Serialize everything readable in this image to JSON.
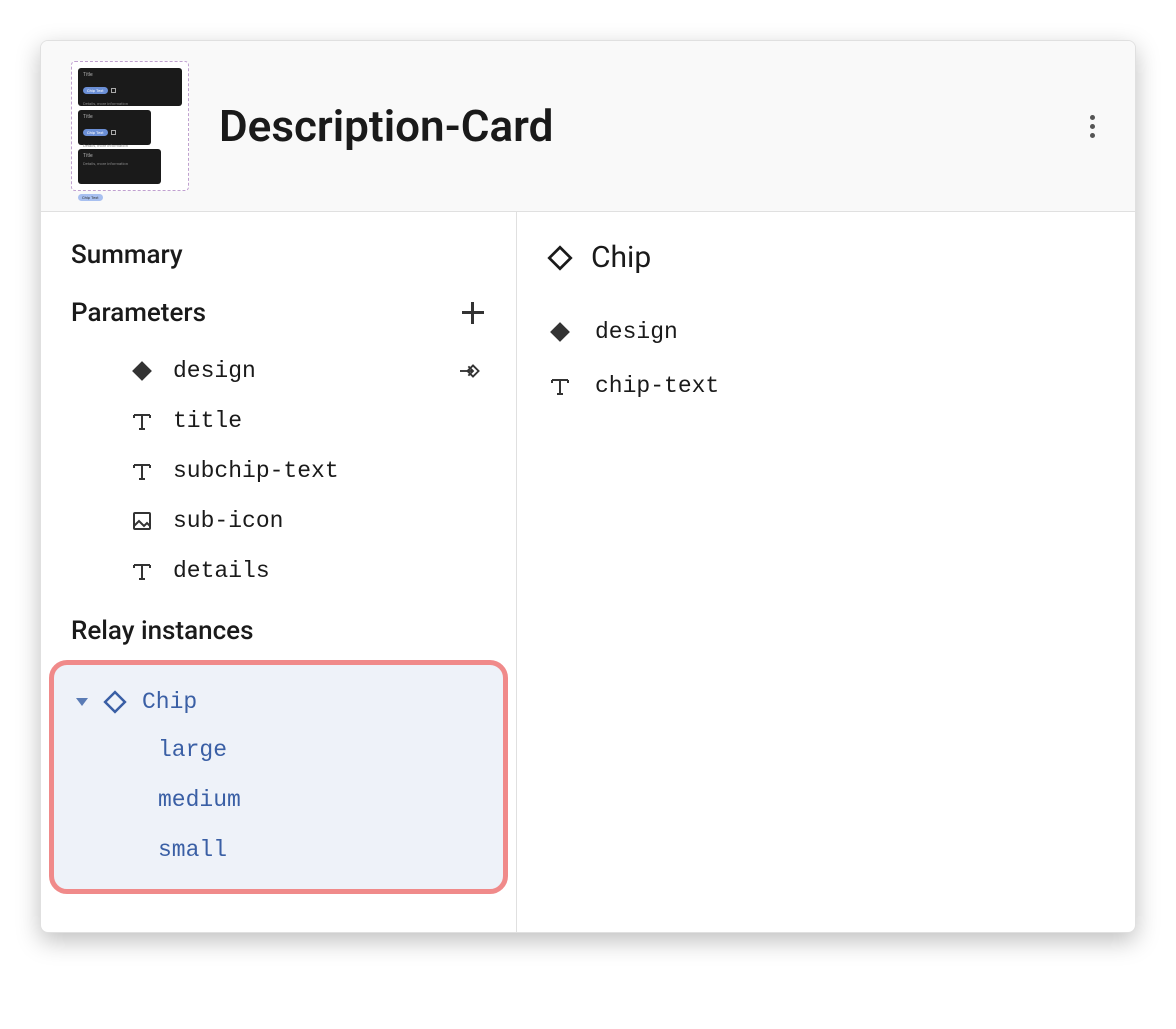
{
  "header": {
    "title": "Description-Card"
  },
  "left": {
    "summary_label": "Summary",
    "parameters_label": "Parameters",
    "parameters": [
      {
        "icon": "diamond-filled",
        "label": "design",
        "has_router": true
      },
      {
        "icon": "text",
        "label": "title",
        "has_router": false
      },
      {
        "icon": "text",
        "label": "subchip-text",
        "has_router": false
      },
      {
        "icon": "image",
        "label": "sub-icon",
        "has_router": false
      },
      {
        "icon": "text",
        "label": "details",
        "has_router": false
      }
    ],
    "relay_instances_label": "Relay instances",
    "instance": {
      "name": "Chip",
      "variants": [
        "large",
        "medium",
        "small"
      ]
    }
  },
  "right": {
    "title": "Chip",
    "properties": [
      {
        "icon": "diamond-filled",
        "label": "design"
      },
      {
        "icon": "text",
        "label": "chip-text"
      }
    ]
  }
}
